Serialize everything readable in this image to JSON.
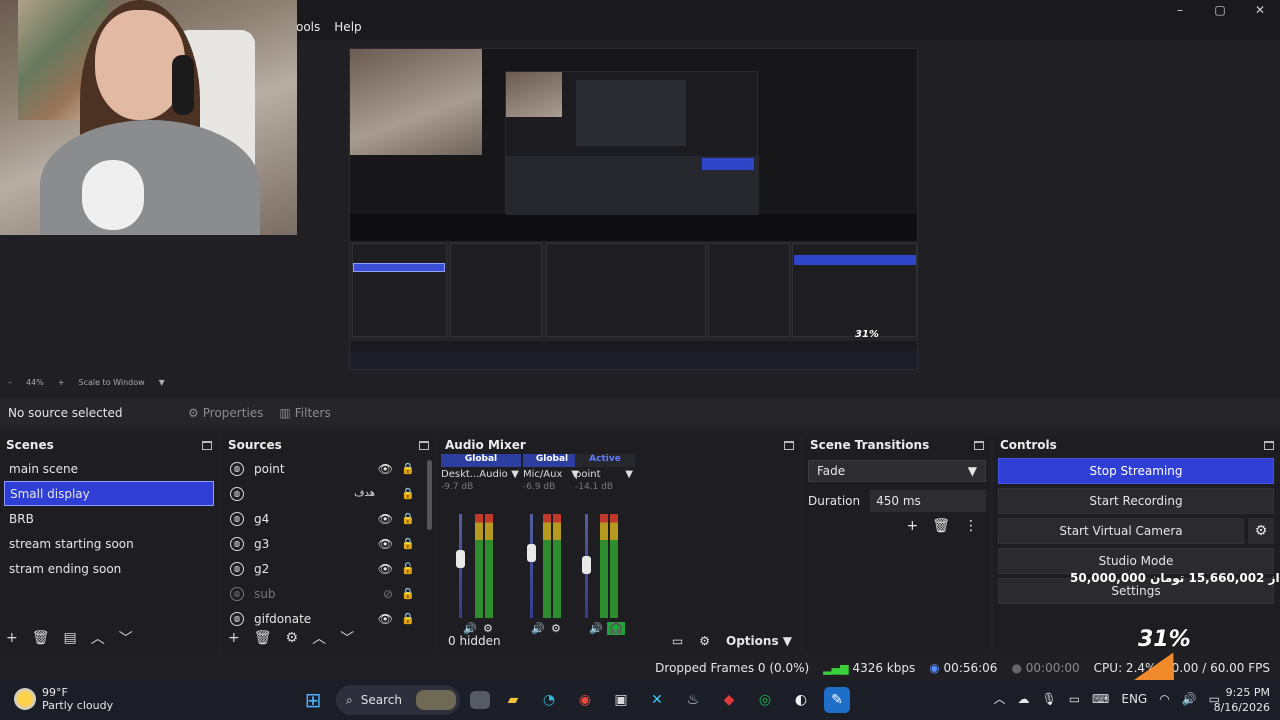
{
  "menu": {
    "tools": "ools",
    "help": "Help"
  },
  "window": {
    "minimize": "–",
    "maximize": "▢",
    "close": "✕"
  },
  "preview": {
    "overlay_percent": "31%"
  },
  "zoom": {
    "minus": "–",
    "level": "44%",
    "plus": "+",
    "mode": "Scale to Window"
  },
  "context_bar": {
    "no_source": "No source selected",
    "properties": "Properties",
    "filters": "Filters"
  },
  "scenes": {
    "title": "Scenes",
    "items": [
      "main scene",
      "Small display",
      "BRB",
      "stream starting soon",
      "stram ending soon"
    ],
    "selected_index": 1
  },
  "sources": {
    "title": "Sources",
    "items": [
      {
        "name": "point",
        "tag": ""
      },
      {
        "name": "",
        "tag": "هدف"
      },
      {
        "name": "g4",
        "tag": ""
      },
      {
        "name": "g3",
        "tag": ""
      },
      {
        "name": "g2",
        "tag": ""
      },
      {
        "name": "sub",
        "tag": ""
      },
      {
        "name": "gifdonate",
        "tag": ""
      }
    ]
  },
  "mixer": {
    "title": "Audio Mixer",
    "channels": [
      {
        "header": "Global",
        "name": "Deskt...Audio",
        "db": "-9.7 dB",
        "level": 0.72
      },
      {
        "header": "Global",
        "name": "Mic/Aux",
        "db": "-6.9 dB",
        "level": 0.84
      },
      {
        "header": "Active",
        "name": "point",
        "db": "-14.1 dB",
        "level": 0.62
      }
    ],
    "scale": [
      "0",
      "-6",
      "-12",
      "-18",
      "-24",
      "-30",
      "-36",
      "-42",
      "-48",
      "-54",
      "-60"
    ],
    "hidden": "0 hidden",
    "options": "Options"
  },
  "transitions": {
    "title": "Scene Transitions",
    "type": "Fade",
    "duration_label": "Duration",
    "duration_value": "450 ms"
  },
  "controls": {
    "title": "Controls",
    "stop_streaming": "Stop Streaming",
    "start_recording": "Start Recording",
    "start_virtual_camera": "Start Virtual Camera",
    "studio_mode": "Studio Mode",
    "settings": "Settings",
    "overlay_text": "50,000,000 از 15,660,002 تومان"
  },
  "status": {
    "dropped": "Dropped Frames 0 (0.0%)",
    "bitrate": "4326 kbps",
    "stream_time": "00:56:06",
    "rec_time": "00:00:00",
    "cpu": "CPU: 2.4%, 60.00 / 60.00 FPS",
    "overlay_percent": "31%"
  },
  "taskbar": {
    "temp": "99°F",
    "weather": "Partly cloudy",
    "search": "Search",
    "lang": "ENG",
    "time": "9:25 PM",
    "date": "8/16/2026"
  },
  "colors": {
    "accent": "#2f3fd6",
    "panel": "#1e1e22",
    "background": "#1f1f24"
  }
}
